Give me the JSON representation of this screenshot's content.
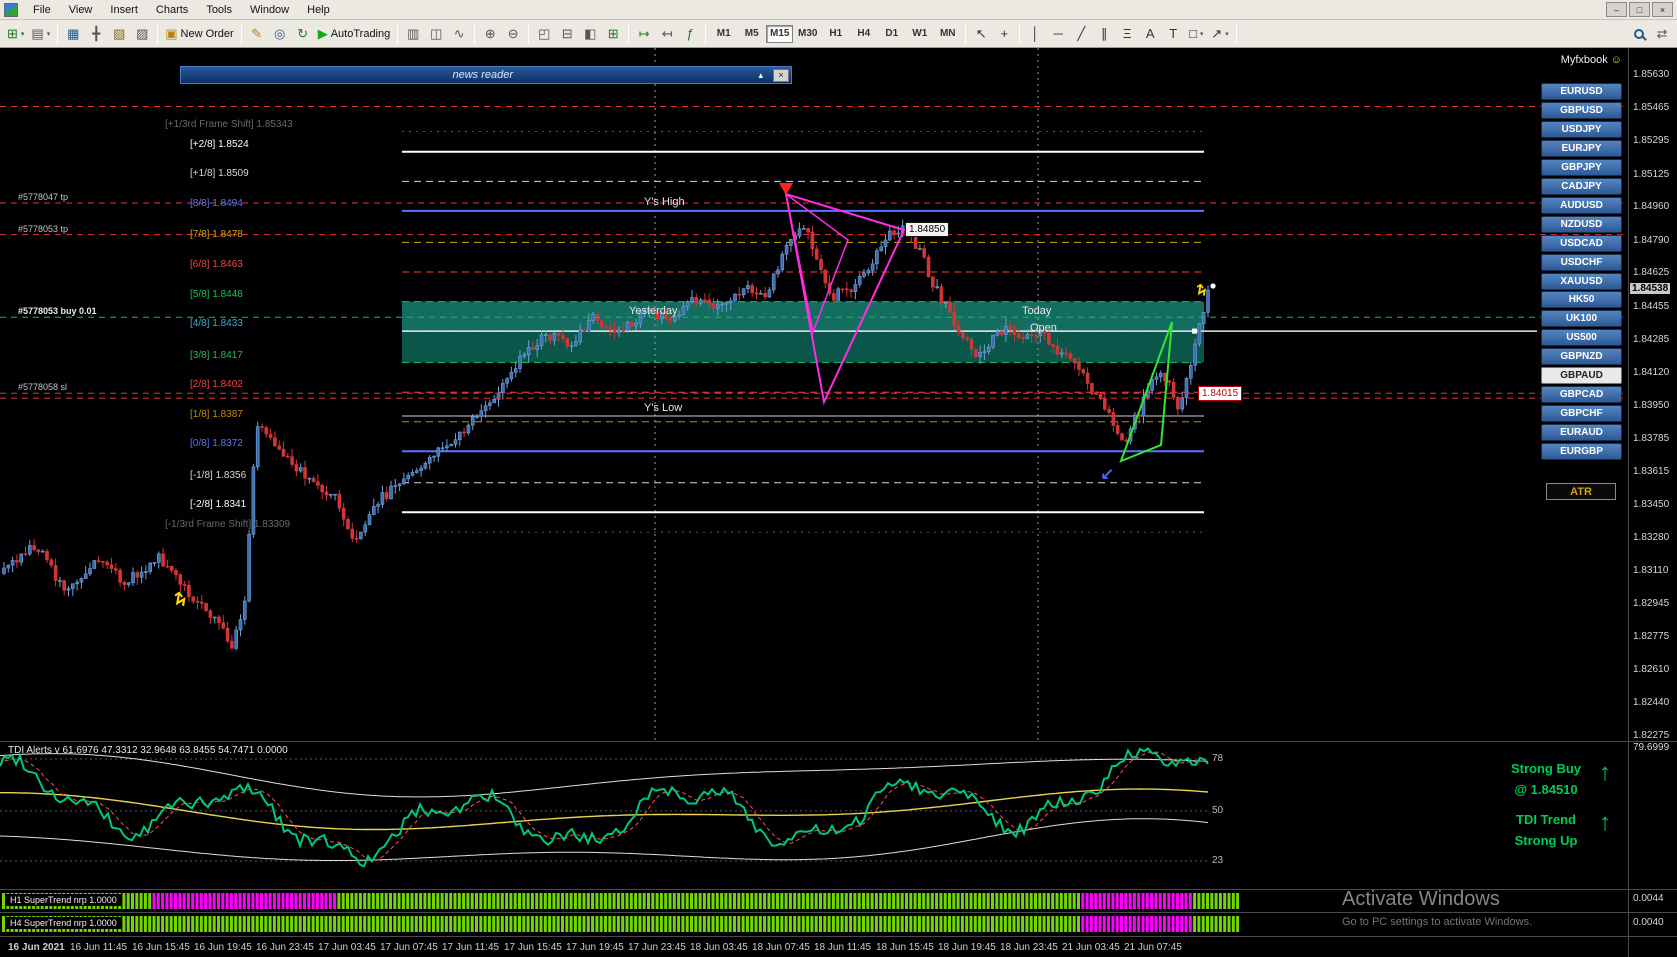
{
  "window": {
    "controls": [
      "–",
      "□",
      "×"
    ]
  },
  "menu": {
    "items": [
      "File",
      "View",
      "Insert",
      "Charts",
      "Tools",
      "Window",
      "Help"
    ]
  },
  "icons": {
    "collapse": "▴",
    "close": "×",
    "smiley": "☺",
    "up_arrow": "↑",
    "dropdown": "▾"
  },
  "toolbar": {
    "groups": [
      {
        "buttons": [
          {
            "name": "new-chart",
            "glyph": "⊞",
            "color": "#1e7a1e",
            "dropdown": true
          },
          {
            "name": "profiles",
            "glyph": "▤",
            "color": "#555",
            "dropdown": true
          }
        ]
      },
      {
        "buttons": [
          {
            "name": "market-watch",
            "glyph": "▦",
            "color": "#1e5a8a"
          },
          {
            "name": "data-window",
            "glyph": "╋",
            "color": "#555"
          },
          {
            "name": "navigator",
            "glyph": "▧",
            "color": "#8a6a1e"
          },
          {
            "name": "terminal",
            "glyph": "▨",
            "color": "#555"
          }
        ]
      },
      {
        "buttons": [
          {
            "name": "new-order",
            "glyph": "▣",
            "color": "#b8860b",
            "label": "New Order"
          }
        ]
      },
      {
        "buttons": [
          {
            "name": "styler",
            "glyph": "✎",
            "color": "#b8860b"
          },
          {
            "name": "alerts",
            "glyph": "◎",
            "color": "#1e5a8a"
          },
          {
            "name": "refresh",
            "glyph": "↻",
            "color": "#1e7a1e"
          },
          {
            "name": "autotrading",
            "glyph": "▶",
            "color": "#11aa11",
            "label": "AutoTrading"
          }
        ]
      },
      {
        "buttons": [
          {
            "name": "bar-chart-mode",
            "glyph": "▥",
            "color": "#555"
          },
          {
            "name": "candlestick-mode",
            "glyph": "◫",
            "color": "#555"
          },
          {
            "name": "line-chart-mode",
            "glyph": "∿",
            "color": "#555"
          }
        ]
      },
      {
        "buttons": [
          {
            "name": "zoom-in",
            "glyph": "⊕",
            "color": "#555"
          },
          {
            "name": "zoom-out",
            "glyph": "⊖",
            "color": "#555"
          }
        ]
      },
      {
        "buttons": [
          {
            "name": "tile-windows",
            "glyph": "◰",
            "color": "#555"
          },
          {
            "name": "tile-horizontal",
            "glyph": "⊟",
            "color": "#555"
          },
          {
            "name": "tile-vertical",
            "glyph": "◧",
            "color": "#555"
          },
          {
            "name": "arrange-grid",
            "glyph": "⊞",
            "color": "#1e7a1e"
          }
        ]
      },
      {
        "buttons": [
          {
            "name": "auto-scroll",
            "glyph": "↦",
            "color": "#1e7a1e"
          },
          {
            "name": "chart-shift",
            "glyph": "↤",
            "color": "#555"
          },
          {
            "name": "indicators",
            "glyph": "ƒ",
            "color": "#1e7a1e"
          }
        ]
      },
      {
        "timeframes": true
      },
      {
        "buttons": [
          {
            "name": "cursor",
            "glyph": "↖",
            "color": "#333"
          },
          {
            "name": "crosshair",
            "glyph": "+",
            "color": "#333"
          }
        ]
      },
      {
        "buttons": [
          {
            "name": "vertical-line",
            "glyph": "│",
            "color": "#333"
          },
          {
            "name": "horizontal-line",
            "glyph": "─",
            "color": "#333"
          },
          {
            "name": "trendline",
            "glyph": "╱",
            "color": "#333"
          },
          {
            "name": "channel",
            "glyph": "∥",
            "color": "#333"
          },
          {
            "name": "fibonacci",
            "glyph": "Ξ",
            "color": "#333"
          },
          {
            "name": "text",
            "glyph": "A",
            "color": "#333"
          },
          {
            "name": "text-label",
            "glyph": "T",
            "color": "#333"
          },
          {
            "name": "shapes",
            "glyph": "□",
            "color": "#333",
            "dropdown": true
          },
          {
            "name": "arrow-tools",
            "glyph": "↗",
            "color": "#333",
            "dropdown": true
          }
        ]
      },
      {
        "right": true,
        "buttons": [
          {
            "name": "quick-search",
            "magnifier": true
          },
          {
            "name": "symbol-switch",
            "glyph": "⇄",
            "color": "#555"
          }
        ]
      }
    ],
    "timeframes": [
      "M1",
      "M5",
      "M15",
      "M30",
      "H1",
      "H4",
      "D1",
      "W1",
      "MN"
    ],
    "active_timeframe": "M15"
  },
  "chart": {
    "news_reader_title": "news reader",
    "myfxbook_label": "Myfxbook",
    "current_price": "1.84538",
    "murray_levels": [
      {
        "label": "[+2/8]",
        "price": "1.8524",
        "color": "#ffffff",
        "style": "solid"
      },
      {
        "label": "[+1/8]",
        "price": "1.8509",
        "color": "#d8d8d8",
        "style": "dashed"
      },
      {
        "label": "[8/8]",
        "price": "1.8494",
        "color": "#5577ff",
        "style": "solid"
      },
      {
        "label": "[7/8]",
        "price": "1.8478",
        "color": "#ccaa00",
        "style": "dashed"
      },
      {
        "label": "[6/8]",
        "price": "1.8463",
        "color": "#ee4444",
        "style": "dashed"
      },
      {
        "label": "[5/8]",
        "price": "1.8448",
        "color": "#22bb55",
        "style": "dashed"
      },
      {
        "label": "[4/8]",
        "price": "1.8433",
        "color": "#44aacc",
        "style": "dashed"
      },
      {
        "label": "[3/8]",
        "price": "1.8417",
        "color": "#22bb55",
        "style": "dashed"
      },
      {
        "label": "[2/8]",
        "price": "1.8402",
        "color": "#ee4444",
        "style": "dashed"
      },
      {
        "label": "[1/8]",
        "price": "1.8387",
        "color": "#cc8800",
        "style": "dashed"
      },
      {
        "label": "[0/8]",
        "price": "1.8372",
        "color": "#5577ff",
        "style": "solid"
      },
      {
        "label": "[-1/8]",
        "price": "1.8356",
        "color": "#d8d8d8",
        "style": "dashed"
      },
      {
        "label": "[-2/8]",
        "price": "1.8341",
        "color": "#ffffff",
        "style": "solid"
      }
    ],
    "frame_shifts": [
      {
        "label": "[+1/3rd Frame Shift]",
        "price": "1.85343"
      },
      {
        "label": "[-1/3rd Frame Shift]",
        "price": "1.83309"
      }
    ],
    "orders": [
      {
        "label": "#5778047 tp",
        "price": 1.8498,
        "type": "tp"
      },
      {
        "label": "#5778053 tp",
        "price": 1.8482,
        "type": "tp"
      },
      {
        "label": "",
        "price": 1.8547,
        "type": "tp"
      },
      {
        "label": "#5778053 buy 0.01",
        "price": 1.844,
        "type": "buy"
      },
      {
        "label": "#5778058 sl",
        "price": 1.84015,
        "type": "sl"
      },
      {
        "label": "",
        "price": 1.8399,
        "type": "sl"
      }
    ],
    "price_tags": [
      {
        "text": "1.84850"
      },
      {
        "text": "1.84015"
      }
    ],
    "session": {
      "yesterday": "Yesterday",
      "today": "Today",
      "open": "Open",
      "ys_high": "Y's High",
      "ys_low": "Y's Low"
    }
  },
  "symbols": {
    "list": [
      "EURUSD",
      "GBPUSD",
      "USDJPY",
      "EURJPY",
      "GBPJPY",
      "CADJPY",
      "AUDUSD",
      "NZDUSD",
      "USDCAD",
      "USDCHF",
      "XAUUSD",
      "HK50",
      "UK100",
      "US500",
      "GBPNZD",
      "GBPAUD",
      "GBPCAD",
      "GBPCHF",
      "EURAUD",
      "EURGBP"
    ],
    "active": "GBPAUD",
    "atr_label": "ATR"
  },
  "price_axis": {
    "values": [
      "1.85630",
      "1.85465",
      "1.85295",
      "1.85125",
      "1.84960",
      "1.84790",
      "1.84625",
      "1.84455",
      "1.84285",
      "1.84120",
      "1.83950",
      "1.83785",
      "1.83615",
      "1.83450",
      "1.83280",
      "1.83110",
      "1.82945",
      "1.82775",
      "1.82610",
      "1.82440",
      "1.82275"
    ],
    "current": "1.84538",
    "tdi_value": "79.6999",
    "st_values": [
      "0.0044",
      "0.0040"
    ]
  },
  "tdi": {
    "title": "TDI Alerts v 61.6976 47.3312 32.9648 63.8455 54.7471 0.0000",
    "levels": [
      "78",
      "50",
      "23"
    ]
  },
  "signal": {
    "line1": "Strong Buy",
    "line2": "@ 1.84510",
    "line3": "TDI Trend",
    "line4": "Strong Up"
  },
  "supertrend": {
    "rows": [
      {
        "label": "H1 SuperTrend nrp 1.0000"
      },
      {
        "label": "H4 SuperTrend nrp 1.0000"
      }
    ]
  },
  "time_axis": [
    "16 Jun 2021",
    "16 Jun 11:45",
    "16 Jun 15:45",
    "16 Jun 19:45",
    "16 Jun 23:45",
    "17 Jun 03:45",
    "17 Jun 07:45",
    "17 Jun 11:45",
    "17 Jun 15:45",
    "17 Jun 19:45",
    "17 Jun 23:45",
    "18 Jun 03:45",
    "18 Jun 07:45",
    "18 Jun 11:45",
    "18 Jun 15:45",
    "18 Jun 19:45",
    "18 Jun 23:45",
    "21 Jun 03:45",
    "21 Jun 07:45"
  ],
  "watermark": {
    "line1": "Activate Windows",
    "line2": "Go to PC settings to activate Windows."
  },
  "chart_data": {
    "type": "candlestick",
    "symbol": "GBPAUD",
    "timeframe": "M15",
    "current_price": 1.84538,
    "visible_price_range": [
      1.8228,
      1.8563
    ],
    "yesterday_zone": {
      "high": 1.8448,
      "mid": 1.8433,
      "low": 1.8417
    },
    "price_path": [
      [
        0,
        1.831
      ],
      [
        35,
        1.8325
      ],
      [
        65,
        1.83
      ],
      [
        95,
        1.8316
      ],
      [
        125,
        1.8306
      ],
      [
        160,
        1.8318
      ],
      [
        190,
        1.83
      ],
      [
        215,
        1.8288
      ],
      [
        232,
        1.8273
      ],
      [
        245,
        1.8296
      ],
      [
        256,
        1.8388
      ],
      [
        275,
        1.8376
      ],
      [
        305,
        1.836
      ],
      [
        335,
        1.8348
      ],
      [
        356,
        1.8325
      ],
      [
        376,
        1.8346
      ],
      [
        400,
        1.8356
      ],
      [
        430,
        1.8368
      ],
      [
        460,
        1.8381
      ],
      [
        490,
        1.8398
      ],
      [
        515,
        1.8416
      ],
      [
        545,
        1.8432
      ],
      [
        570,
        1.8426
      ],
      [
        595,
        1.844
      ],
      [
        620,
        1.8431
      ],
      [
        645,
        1.8444
      ],
      [
        670,
        1.8437
      ],
      [
        695,
        1.845
      ],
      [
        720,
        1.8443
      ],
      [
        745,
        1.8457
      ],
      [
        765,
        1.8451
      ],
      [
        788,
        1.8477
      ],
      [
        802,
        1.8489
      ],
      [
        818,
        1.8468
      ],
      [
        832,
        1.8451
      ],
      [
        848,
        1.8453
      ],
      [
        865,
        1.8463
      ],
      [
        885,
        1.848
      ],
      [
        902,
        1.8487
      ],
      [
        918,
        1.8476
      ],
      [
        932,
        1.8458
      ],
      [
        948,
        1.8443
      ],
      [
        963,
        1.8431
      ],
      [
        978,
        1.8419
      ],
      [
        992,
        1.8429
      ],
      [
        1008,
        1.8437
      ],
      [
        1022,
        1.8428
      ],
      [
        1038,
        1.8434
      ],
      [
        1052,
        1.8425
      ],
      [
        1068,
        1.842
      ],
      [
        1082,
        1.8411
      ],
      [
        1098,
        1.8401
      ],
      [
        1112,
        1.8389
      ],
      [
        1124,
        1.8377
      ],
      [
        1138,
        1.8391
      ],
      [
        1150,
        1.8405
      ],
      [
        1160,
        1.8415
      ],
      [
        1170,
        1.8404
      ],
      [
        1180,
        1.8392
      ],
      [
        1190,
        1.8415
      ],
      [
        1200,
        1.8439
      ],
      [
        1209,
        1.8453
      ]
    ],
    "tdi_levels": [
      78,
      50,
      23
    ],
    "tdi_current": 79.6999,
    "supertrend_rows": [
      {
        "label": "H1 SuperTrend nrp 1.0000",
        "segments": [
          [
            0,
            0.12,
            "up"
          ],
          [
            0.12,
            0.27,
            "down"
          ],
          [
            0.27,
            0.872,
            "up"
          ],
          [
            0.872,
            0.962,
            "down"
          ],
          [
            0.962,
            1.01,
            "up"
          ]
        ]
      },
      {
        "label": "H4 SuperTrend nrp 1.0000",
        "segments": [
          [
            0,
            0.872,
            "up"
          ],
          [
            0.872,
            0.962,
            "down"
          ],
          [
            0.962,
            1.01,
            "up"
          ]
        ]
      }
    ]
  }
}
